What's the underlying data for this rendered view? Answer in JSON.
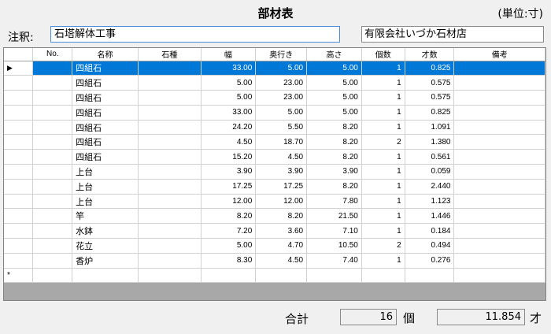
{
  "header": {
    "title": "部材表",
    "unit_label": "(単位:寸)"
  },
  "note": {
    "label": "注釈:",
    "value": "石塔解体工事"
  },
  "company": {
    "value": "有限会社いづか石材店"
  },
  "grid": {
    "columns": [
      "No.",
      "名称",
      "石種",
      "幅",
      "奥行き",
      "高さ",
      "個数",
      "才数",
      "備考"
    ],
    "rows": [
      {
        "no": "",
        "name": "四組石",
        "stone": "",
        "width": "33.00",
        "depth": "5.00",
        "height": "5.00",
        "count": "1",
        "volume": "0.825",
        "note": ""
      },
      {
        "no": "",
        "name": "四組石",
        "stone": "",
        "width": "5.00",
        "depth": "23.00",
        "height": "5.00",
        "count": "1",
        "volume": "0.575",
        "note": ""
      },
      {
        "no": "",
        "name": "四組石",
        "stone": "",
        "width": "5.00",
        "depth": "23.00",
        "height": "5.00",
        "count": "1",
        "volume": "0.575",
        "note": ""
      },
      {
        "no": "",
        "name": "四組石",
        "stone": "",
        "width": "33.00",
        "depth": "5.00",
        "height": "5.00",
        "count": "1",
        "volume": "0.825",
        "note": ""
      },
      {
        "no": "",
        "name": "四組石",
        "stone": "",
        "width": "24.20",
        "depth": "5.50",
        "height": "8.20",
        "count": "1",
        "volume": "1.091",
        "note": ""
      },
      {
        "no": "",
        "name": "四組石",
        "stone": "",
        "width": "4.50",
        "depth": "18.70",
        "height": "8.20",
        "count": "2",
        "volume": "1.380",
        "note": ""
      },
      {
        "no": "",
        "name": "四組石",
        "stone": "",
        "width": "15.20",
        "depth": "4.50",
        "height": "8.20",
        "count": "1",
        "volume": "0.561",
        "note": ""
      },
      {
        "no": "",
        "name": "上台",
        "stone": "",
        "width": "3.90",
        "depth": "3.90",
        "height": "3.90",
        "count": "1",
        "volume": "0.059",
        "note": ""
      },
      {
        "no": "",
        "name": "上台",
        "stone": "",
        "width": "17.25",
        "depth": "17.25",
        "height": "8.20",
        "count": "1",
        "volume": "2.440",
        "note": ""
      },
      {
        "no": "",
        "name": "上台",
        "stone": "",
        "width": "12.00",
        "depth": "12.00",
        "height": "7.80",
        "count": "1",
        "volume": "1.123",
        "note": ""
      },
      {
        "no": "",
        "name": "竿",
        "stone": "",
        "width": "8.20",
        "depth": "8.20",
        "height": "21.50",
        "count": "1",
        "volume": "1.446",
        "note": ""
      },
      {
        "no": "",
        "name": "水鉢",
        "stone": "",
        "width": "7.20",
        "depth": "3.60",
        "height": "7.10",
        "count": "1",
        "volume": "0.184",
        "note": ""
      },
      {
        "no": "",
        "name": "花立",
        "stone": "",
        "width": "5.00",
        "depth": "4.70",
        "height": "10.50",
        "count": "2",
        "volume": "0.494",
        "note": ""
      },
      {
        "no": "",
        "name": "香炉",
        "stone": "",
        "width": "8.30",
        "depth": "4.50",
        "height": "7.40",
        "count": "1",
        "volume": "0.276",
        "note": ""
      }
    ],
    "selected_marker": "▶",
    "new_row_marker": "*"
  },
  "totals": {
    "label": "合計",
    "count": "16",
    "count_unit": "個",
    "volume": "11.854",
    "volume_unit": "才"
  },
  "colors": {
    "selection": "#0078d7",
    "focus_border": "#4a8cd6"
  }
}
